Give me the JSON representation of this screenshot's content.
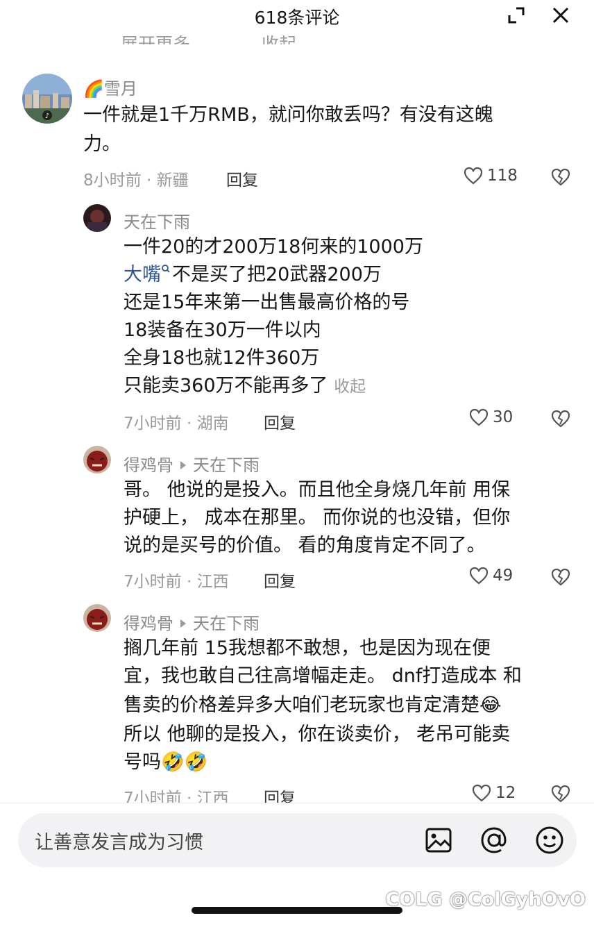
{
  "header": {
    "title": "618条评论"
  },
  "comments": [
    {
      "user": "🌈雪月",
      "lines": [
        "一件就是1千万RMB，就问你敢丢吗？有没有这魄",
        "力。"
      ],
      "meta": "8小时前 · 新疆",
      "reply_label": "回复",
      "likes": "118"
    },
    {
      "user": "天在下雨",
      "lines": [
        "一件20的才200万18何来的1000万",
        "不是买了把20武器200万",
        "还是15年来第一出售最高价格的号",
        "18装备在30万一件以内",
        "全身18也就12件360万",
        "只能卖360万不能再多了"
      ],
      "link_text": "大嘴",
      "collapse_label": "收起",
      "meta": "7小时前 · 湖南",
      "reply_label": "回复",
      "likes": "30"
    },
    {
      "user": "得鸡骨",
      "reply_to": "天在下雨",
      "lines": [
        "哥。 他说的是投入。而且他全身烧几年前 用保",
        "护硬上， 成本在那里。 而你说的也没错，但你",
        "说的是买号的价值。  看的角度肯定不同了。"
      ],
      "meta": "7小时前 · 江西",
      "reply_label": "回复",
      "likes": "49"
    },
    {
      "user": "得鸡骨",
      "reply_to": "天在下雨",
      "lines": [
        "搁几年前 15我想都不敢想，也是因为现在便",
        "宜，我也敢自己往高增幅走走。 dnf打造成本 和",
        "售卖的价格差异多大咱们老玩家也肯定清楚😂",
        "所以  他聊的是投入，你在谈卖价，  老吊可能卖",
        "号吗🤣🤣"
      ],
      "meta": "7小时前 · 江西",
      "reply_label": "回复",
      "likes": "12"
    }
  ],
  "cut_off_top": {
    "left": "展开更多",
    "right": "收起"
  },
  "input": {
    "placeholder": "让善意发言成为习惯"
  },
  "watermark": "COLG @ColGyhOvO",
  "colors": {
    "link": "#2f5596",
    "meta": "#9a9a9a"
  }
}
